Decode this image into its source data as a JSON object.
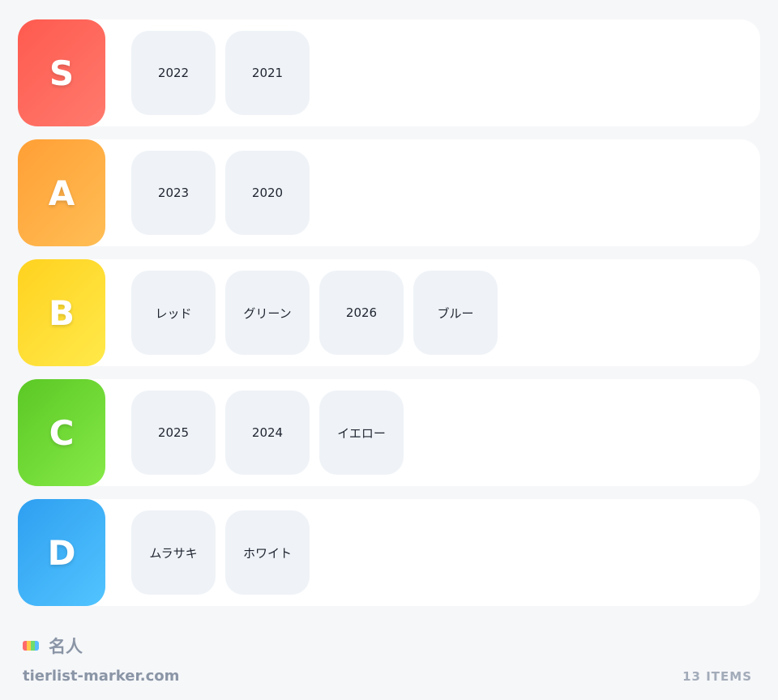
{
  "tiers": [
    {
      "label": "S",
      "gradient": [
        "#ff5a4f",
        "#ff7a6d"
      ],
      "items": [
        "2022",
        "2021"
      ]
    },
    {
      "label": "A",
      "gradient": [
        "#ff9f35",
        "#ffbe55"
      ],
      "items": [
        "2023",
        "2020"
      ]
    },
    {
      "label": "B",
      "gradient": [
        "#ffd21f",
        "#ffe94a"
      ],
      "items": [
        "レッド",
        "グリーン",
        "2026",
        "ブルー"
      ]
    },
    {
      "label": "C",
      "gradient": [
        "#5bc825",
        "#86ea47"
      ],
      "items": [
        "2025",
        "2024",
        "イエロー"
      ]
    },
    {
      "label": "D",
      "gradient": [
        "#2e9ff0",
        "#52c4ff"
      ],
      "items": [
        "ムラサキ",
        "ホワイト"
      ]
    }
  ],
  "footer": {
    "title": "名人",
    "site": "tierlist-marker.com",
    "count_label": "13 ITEMS",
    "icon": "rainbow-stripes-icon",
    "icon_colors": [
      "#ff6b6b",
      "#ffc94a",
      "#6fdc6f",
      "#5bbcff"
    ]
  }
}
